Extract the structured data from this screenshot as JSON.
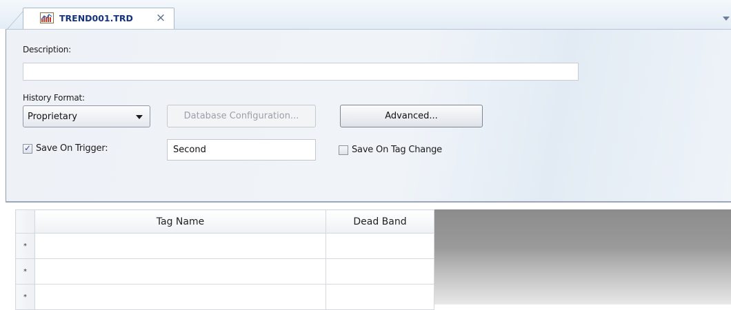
{
  "tab": {
    "title": "TREND001.TRD",
    "close_glyph": "×",
    "icon": "trend-chart-icon"
  },
  "form": {
    "description_label": "Description:",
    "description_value": "",
    "history_format_label": "History Format:",
    "history_format_value": "Proprietary",
    "database_config_label": "Database Configuration...",
    "advanced_label": "Advanced...",
    "save_on_trigger_label": "Save On Trigger:",
    "save_on_trigger_checked": true,
    "trigger_value": "Second",
    "save_on_tag_change_label": "Save On Tag Change",
    "save_on_tag_change_checked": false
  },
  "grid": {
    "columns": [
      "Tag Name",
      "Dead Band"
    ],
    "rows": [
      {
        "marker": "*",
        "tag_name": "",
        "dead_band": ""
      },
      {
        "marker": "*",
        "tag_name": "",
        "dead_band": ""
      },
      {
        "marker": "*",
        "tag_name": "",
        "dead_band": ""
      }
    ]
  },
  "colors": {
    "tab_text": "#16347c",
    "accent_check": "#2d4fa0"
  }
}
